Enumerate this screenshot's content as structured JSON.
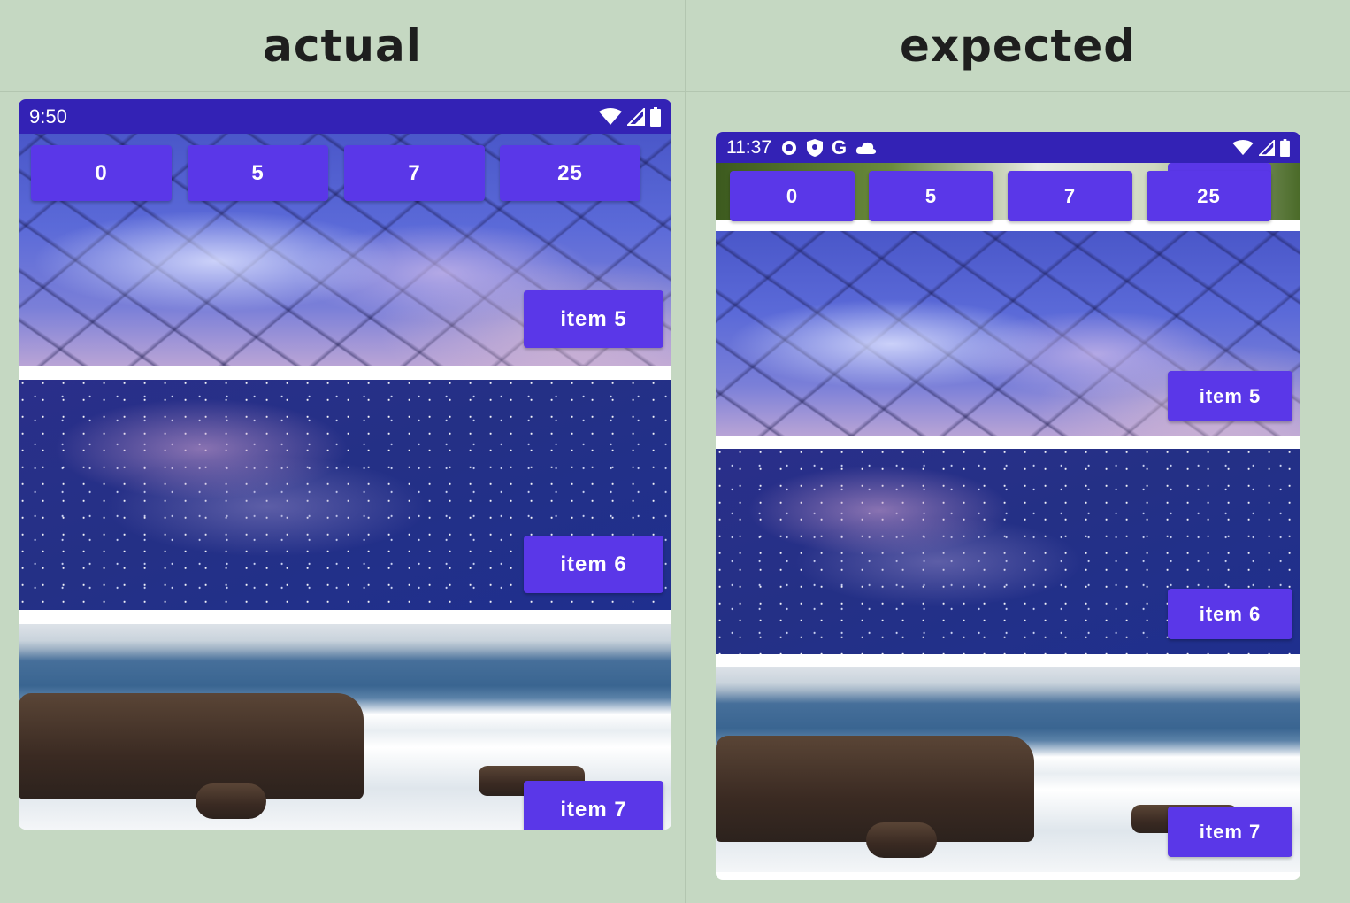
{
  "headers": {
    "actual": "actual",
    "expected": "expected"
  },
  "actual": {
    "status": {
      "time": "9:50",
      "icons": [
        "wifi-icon",
        "signal-icon",
        "battery-icon"
      ]
    },
    "top_buttons": [
      "0",
      "5",
      "7",
      "25"
    ],
    "items": [
      {
        "label": "item 5",
        "image": "cherry-blossom"
      },
      {
        "label": "item 6",
        "image": "milky-way"
      },
      {
        "label": "item 7",
        "image": "sea-rocks"
      }
    ]
  },
  "expected": {
    "status": {
      "time": "11:37",
      "left_icons": [
        "gear-icon",
        "shield-icon",
        "google-icon",
        "cloud-icon"
      ],
      "icons": [
        "wifi-icon",
        "signal-icon",
        "battery-icon"
      ]
    },
    "top_buttons": [
      "0",
      "5",
      "7",
      "25"
    ],
    "items": [
      {
        "label": "item 5",
        "image": "cherry-blossom"
      },
      {
        "label": "item 6",
        "image": "milky-way"
      },
      {
        "label": "item 7",
        "image": "sea-rocks"
      }
    ]
  },
  "colors": {
    "accent": "#5a37e8",
    "status_bar": "#3322b5",
    "page_bg": "#c5d8c2"
  }
}
